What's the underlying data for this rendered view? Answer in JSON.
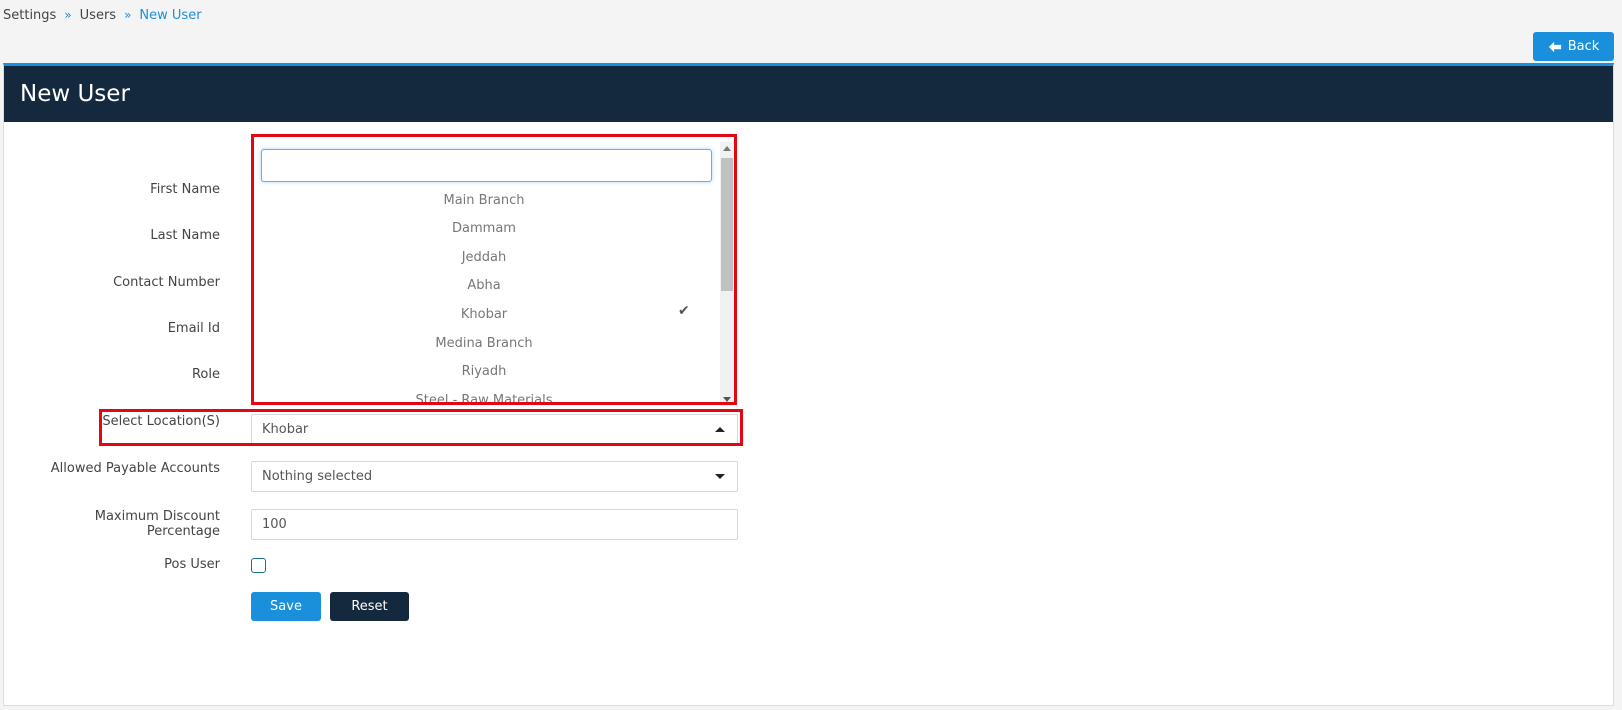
{
  "breadcrumb": {
    "items": [
      "Settings",
      "Users",
      "New User"
    ],
    "separator": "»"
  },
  "back_button": {
    "label": "Back",
    "icon": "arrow-left-icon"
  },
  "panel": {
    "title": "New User"
  },
  "form": {
    "first_name_label": "First Name",
    "last_name_label": "Last Name",
    "contact_number_label": "Contact Number",
    "email_label": "Email Id",
    "role_label": "Role",
    "location_label": "Select Location(S)",
    "location_value": "Khobar",
    "payable_label": "Allowed Payable Accounts",
    "payable_value": "Nothing selected",
    "discount_label": "Maximum Discount Percentage",
    "discount_value": "100",
    "pos_user_label": "Pos User",
    "pos_user_checked": false,
    "save_label": "Save",
    "reset_label": "Reset"
  },
  "location_dropdown": {
    "search_value": "",
    "options": [
      "Main Branch",
      "Dammam",
      "Jeddah",
      "Abha",
      "Khobar",
      "Medina Branch",
      "Riyadh",
      "Steel - Raw Materials"
    ],
    "selected": "Khobar",
    "check_icon": "checkmark-icon"
  },
  "colors": {
    "accent": "#1a8fdb",
    "header_bg": "#14293e",
    "highlight": "#e30613"
  }
}
